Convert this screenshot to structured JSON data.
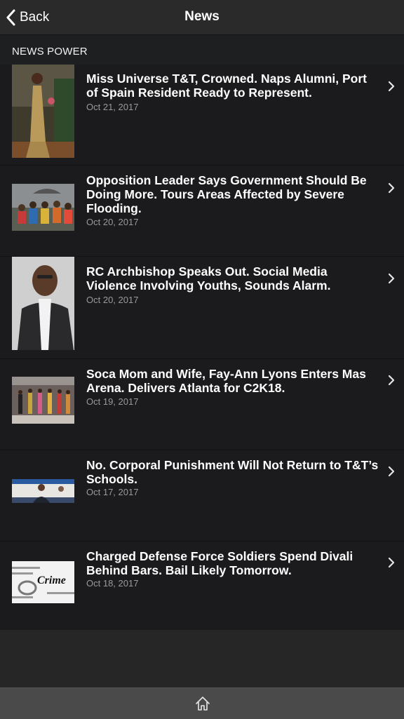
{
  "nav": {
    "back_label": "Back",
    "title": "News"
  },
  "section": {
    "label": "NEWS POWER"
  },
  "articles": [
    {
      "headline": "Miss Universe T&T, Crowned. Naps Alumni, Port of Spain Resident Ready to Represent.",
      "date": "Oct 21, 2017"
    },
    {
      "headline": "Opposition Leader Says Government Should Be Doing More. Tours Areas Affected by Severe Flooding.",
      "date": "Oct 20, 2017"
    },
    {
      "headline": "RC Archbishop Speaks Out. Social Media Violence Involving Youths, Sounds Alarm.",
      "date": "Oct 20, 2017"
    },
    {
      "headline": "Soca Mom and Wife, Fay-Ann Lyons Enters Mas Arena. Delivers Atlanta for C2K18.",
      "date": "Oct 19, 2017"
    },
    {
      "headline": "No. Corporal Punishment Will Not Return to T&T’s Schools.",
      "date": "Oct 17, 2017"
    },
    {
      "headline": "Charged Defense Force Soldiers Spend Divali Behind Bars. Bail Likely Tomorrow.",
      "date": "Oct 18, 2017"
    }
  ],
  "thumb_texts": {
    "crime_word": "Crime"
  },
  "icons": {
    "back": "chevron-left-icon",
    "row_chevron": "chevron-right-icon",
    "home": "home-icon"
  }
}
